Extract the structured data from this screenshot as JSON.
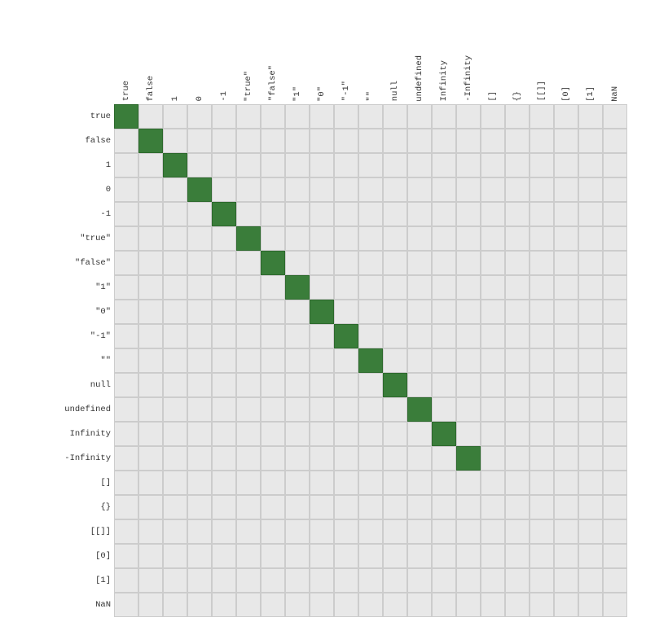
{
  "rowLabels": [
    "true",
    "false",
    "1",
    "0",
    "-1",
    "\"true\"",
    "\"false\"",
    "\"1\"",
    "\"0\"",
    "\"-1\"",
    "\"\"",
    "null",
    "undefined",
    "Infinity",
    "-Infinity",
    "[]",
    "{}",
    "[[]]",
    "[0]",
    "[1]",
    "NaN"
  ],
  "colLabels": [
    "true",
    "false",
    "1",
    "0",
    "-1",
    "\"true\"",
    "\"false\"",
    "\"1\"",
    "\"0\"",
    "\"-1\"",
    "\"\"",
    "null",
    "undefined",
    "Infinity",
    "-Infinity",
    "[]",
    "{}",
    "[[]]",
    "[0]",
    "[1]",
    "NaN"
  ],
  "activeColor": "#3a7d3a",
  "inactiveColor": "#e8e8e8",
  "activeCells": [
    [
      0,
      0
    ],
    [
      1,
      1
    ],
    [
      2,
      2
    ],
    [
      3,
      3
    ],
    [
      4,
      4
    ],
    [
      5,
      5
    ],
    [
      6,
      6
    ],
    [
      7,
      7
    ],
    [
      8,
      8
    ],
    [
      9,
      9
    ],
    [
      10,
      10
    ],
    [
      11,
      11
    ],
    [
      12,
      12
    ],
    [
      13,
      13
    ],
    [
      14,
      14
    ]
  ]
}
